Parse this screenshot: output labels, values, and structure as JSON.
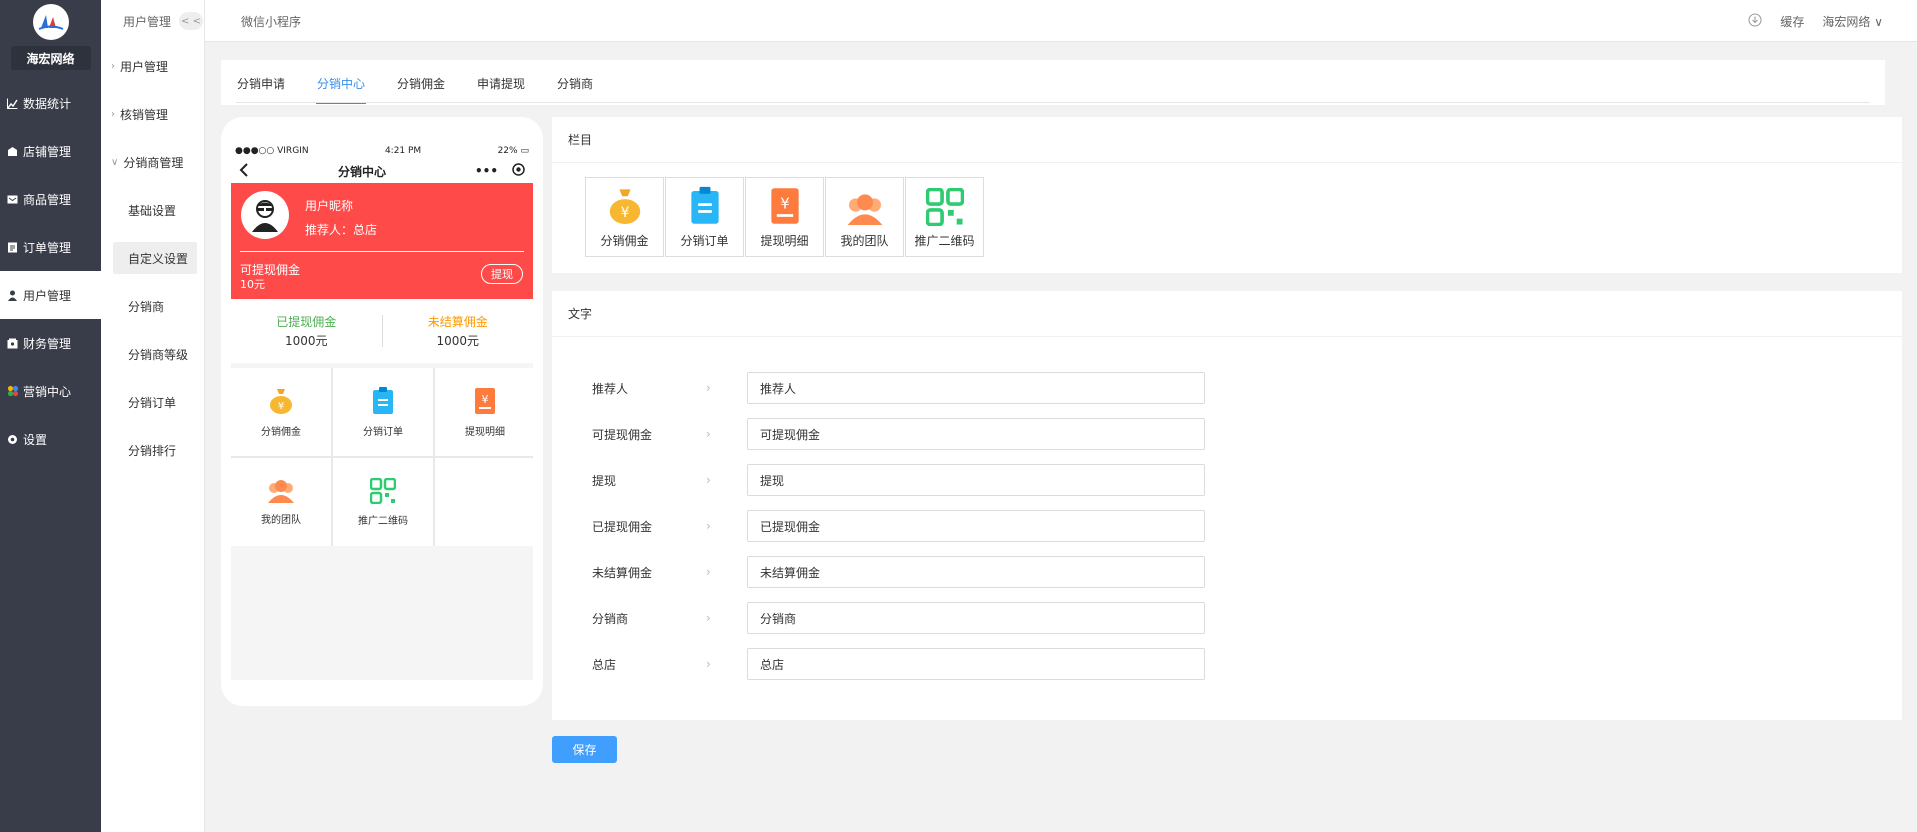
{
  "brand": {
    "name": "海宏网络"
  },
  "sidebar": {
    "items": [
      {
        "label": "数据统计",
        "icon": "chart-icon"
      },
      {
        "label": "店铺管理",
        "icon": "store-icon"
      },
      {
        "label": "商品管理",
        "icon": "goods-icon"
      },
      {
        "label": "订单管理",
        "icon": "order-icon"
      },
      {
        "label": "用户管理",
        "icon": "user-icon",
        "active": true
      },
      {
        "label": "财务管理",
        "icon": "finance-icon"
      },
      {
        "label": "营销中心",
        "icon": "marketing-icon"
      },
      {
        "label": "设置",
        "icon": "settings-icon"
      }
    ]
  },
  "subnav": {
    "title": "用户管理",
    "collapse": "< <",
    "groups": {
      "user": "用户管理",
      "verify": "核销管理",
      "distributor": "分销商管理"
    },
    "items": [
      "基础设置",
      "自定义设置",
      "分销商",
      "分销商等级",
      "分销订单",
      "分销排行"
    ]
  },
  "topbar": {
    "crumb": "微信小程序",
    "cache": "缓存",
    "user": "海宏网络 ∨"
  },
  "tabs": [
    "分销申请",
    "分销中心",
    "分销佣金",
    "申请提现",
    "分销商"
  ],
  "phone": {
    "status": {
      "carrier": "●●●○○ VIRGIN",
      "time": "4:21 PM",
      "battery": "22%"
    },
    "title": "分销中心",
    "nickname": "用户昵称",
    "referrer": "推荐人：总店",
    "withdrawable_label": "可提现佣金",
    "withdrawable_value": "10元",
    "withdraw_button": "提现",
    "stats": [
      {
        "label": "已提现佣金",
        "value": "1000元",
        "color": "#4caf50"
      },
      {
        "label": "未结算佣金",
        "value": "1000元",
        "color": "#ff9800"
      }
    ],
    "grid": [
      "分销佣金",
      "分销订单",
      "提现明细",
      "我的团队",
      "推广二维码"
    ]
  },
  "panel_columns": {
    "title": "栏目",
    "items": [
      "分销佣金",
      "分销订单",
      "提现明细",
      "我的团队",
      "推广二维码"
    ]
  },
  "panel_text": {
    "title": "文字",
    "fields": [
      {
        "label": "推荐人",
        "value": "推荐人"
      },
      {
        "label": "可提现佣金",
        "value": "可提现佣金"
      },
      {
        "label": "提现",
        "value": "提现"
      },
      {
        "label": "已提现佣金",
        "value": "已提现佣金"
      },
      {
        "label": "未结算佣金",
        "value": "未结算佣金"
      },
      {
        "label": "分销商",
        "value": "分销商"
      },
      {
        "label": "总店",
        "value": "总店"
      }
    ]
  },
  "save_label": "保存",
  "colors": {
    "accent": "#409eff",
    "hero": "#ff4a4a",
    "sidebar": "#393d49"
  }
}
